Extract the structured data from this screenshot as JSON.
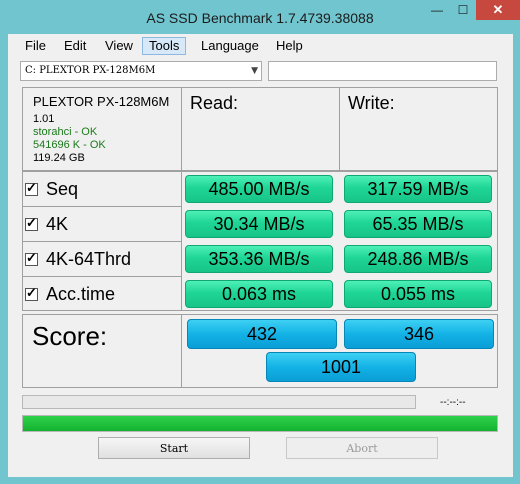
{
  "window": {
    "title": "AS SSD Benchmark 1.7.4739.38088",
    "minimize": "—",
    "maximize": "☐",
    "close": "✕"
  },
  "menu": [
    "File",
    "Edit",
    "View",
    "Tools",
    "Language",
    "Help"
  ],
  "menu_active": "Tools",
  "drive_select": {
    "value": "C: PLEXTOR PX-128M6M",
    "arrow": "▼"
  },
  "side_input": {
    "value": ""
  },
  "drive_info": {
    "model": "PLEXTOR PX-128M6M",
    "firmware": "1.01",
    "driver": "storahci - OK",
    "alignment": "541696 K - OK",
    "capacity": "119.24 GB"
  },
  "columns": {
    "read": "Read:",
    "write": "Write:"
  },
  "tests": [
    {
      "label": "Seq",
      "checked": true,
      "read": "485.00 MB/s",
      "write": "317.59 MB/s"
    },
    {
      "label": "4K",
      "checked": true,
      "read": "30.34 MB/s",
      "write": "65.35 MB/s"
    },
    {
      "label": "4K-64Thrd",
      "checked": true,
      "read": "353.36 MB/s",
      "write": "248.86 MB/s"
    },
    {
      "label": "Acc.time",
      "checked": true,
      "read": "0.063 ms",
      "write": "0.055 ms"
    }
  ],
  "score": {
    "label": "Score:",
    "read": "432",
    "write": "346",
    "total": "1001"
  },
  "progress": {
    "elapsed": "--:--:--",
    "total_fraction": 1.0
  },
  "buttons": {
    "start": "Start",
    "abort": "Abort"
  },
  "colors": {
    "result_green": "#1fd696",
    "score_blue": "#13b2e6",
    "progress_green": "#13b231",
    "close_red": "#c7483e"
  }
}
